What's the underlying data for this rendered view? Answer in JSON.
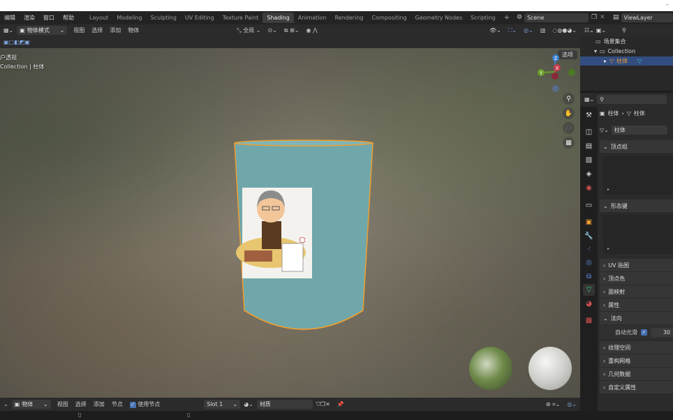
{
  "top_menu": [
    "编辑",
    "渲染",
    "窗口",
    "帮助"
  ],
  "workspaces": [
    "Layout",
    "Modeling",
    "Sculpting",
    "UV Editing",
    "Texture Paint",
    "Shading",
    "Animation",
    "Rendering",
    "Compositing",
    "Geometry Nodes",
    "Scripting"
  ],
  "active_workspace": "Shading",
  "scene_name": "Scene",
  "view_layer": "ViewLayer",
  "viewport_header": {
    "mode": "物体模式",
    "menus": [
      "视图",
      "选择",
      "添加",
      "物体"
    ],
    "transform": "全局"
  },
  "viewport": {
    "view_name": "用户透视",
    "view_name_visible": "户透视",
    "collection_label": "Collection | 柱体",
    "options": "选项",
    "axis_x": "X",
    "axis_y": "Y",
    "axis_z": "Z"
  },
  "shader_header": {
    "object": "物体",
    "menus": [
      "视图",
      "选择",
      "添加",
      "节点"
    ],
    "use_nodes": "使用节点",
    "slot": "Slot 1",
    "material": "材质"
  },
  "outliner": {
    "scene_collection": "场景集合",
    "collection": "Collection",
    "object": "柱体"
  },
  "properties": {
    "breadcrumb_object": "柱体",
    "breadcrumb_mesh": "柱体",
    "mesh_name": "柱体",
    "panels": {
      "vertex_groups": "顶点组",
      "shape_keys": "形态键",
      "uv_maps": "UV 贴图",
      "vertex_colors": "顶点色",
      "face_maps": "面映射",
      "attributes": "属性",
      "normals": "法向",
      "auto_smooth": "自动光滑",
      "auto_smooth_value": "30",
      "texture_space": "纹理空间",
      "remesh": "重构网格",
      "geometry_data": "几何数据",
      "custom_props": "自定义属性"
    }
  },
  "colors": {
    "accent": "#4772b3",
    "selection_outline": "#f0a030",
    "cylinder": "#6fa7ab",
    "axis_x": "#c83a4a",
    "axis_y": "#6ca02a",
    "axis_z": "#3a7fd0"
  }
}
